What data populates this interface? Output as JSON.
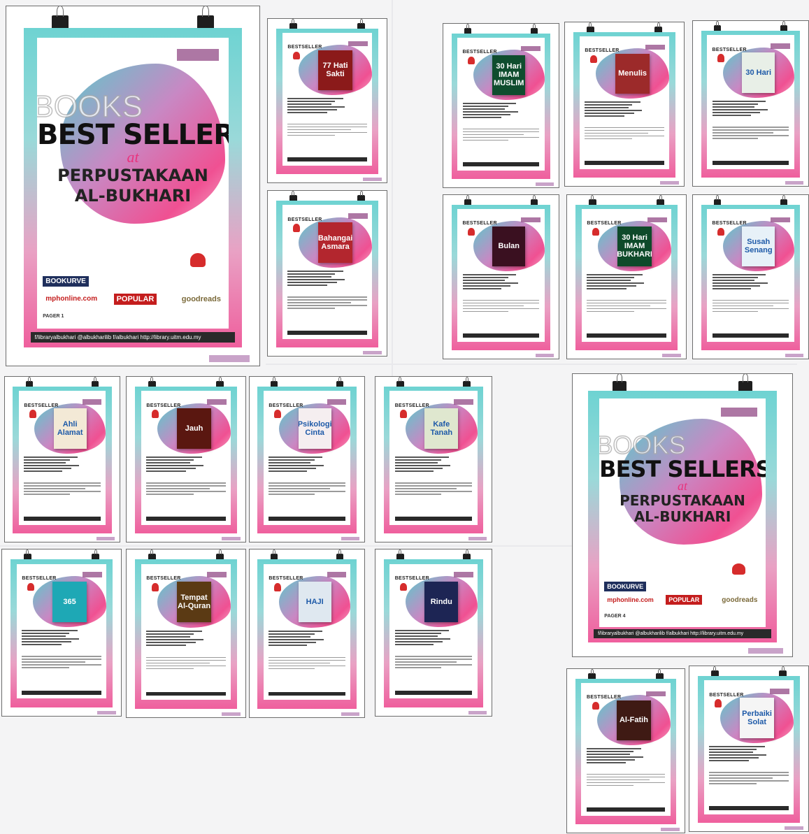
{
  "main_poster": {
    "title_books": "BOOKS",
    "title_best": "BEST SELLERS",
    "title_at": "at",
    "title_place1": "PERPUSTAKAAN",
    "title_place2": "AL-BUKHARI",
    "sponsor_bookurve": "BOOKURVE",
    "sponsor_mph": "mphonline.com",
    "sponsor_popular": "POPULAR",
    "sponsor_goodreads": "goodreads",
    "page_label": "PAGER 1",
    "social": "f/libraryalbukhari    @albukharilib    f/albukhari    http://library.uitm.edu.my"
  },
  "second_poster": {
    "title_books": "BOOKS",
    "title_best": "BEST SELLERS",
    "title_at": "at",
    "title_place1": "PERPUSTAKAAN",
    "title_place2": "AL-BUKHARI",
    "sponsor_bookurve": "BOOKURVE",
    "sponsor_mph": "mphonline.com",
    "sponsor_popular": "POPULAR",
    "sponsor_goodreads": "goodreads",
    "page_label": "PAGER 4",
    "social": "f/libraryalbukhari    @albukharilib    f/albukhari    http://library.uitm.edu.my"
  },
  "badge_text": "BESTSELLER",
  "book_titles": [
    "77 Hati Sakti",
    "30 Hari IMAM MUSLIM",
    "Menulis",
    "30 Hari",
    "Bahangai Asmara",
    "Bulan",
    "30 Hari IMAM BUKHARI",
    "Susah Senang",
    "Ahli Alamat",
    "Jauh",
    "Psikologi Cinta",
    "Kafe Tanah",
    "365",
    "Tempat Al-Quran",
    "HAJI",
    "Rindu",
    "Al-Fatih",
    "Perbaiki Solat"
  ]
}
